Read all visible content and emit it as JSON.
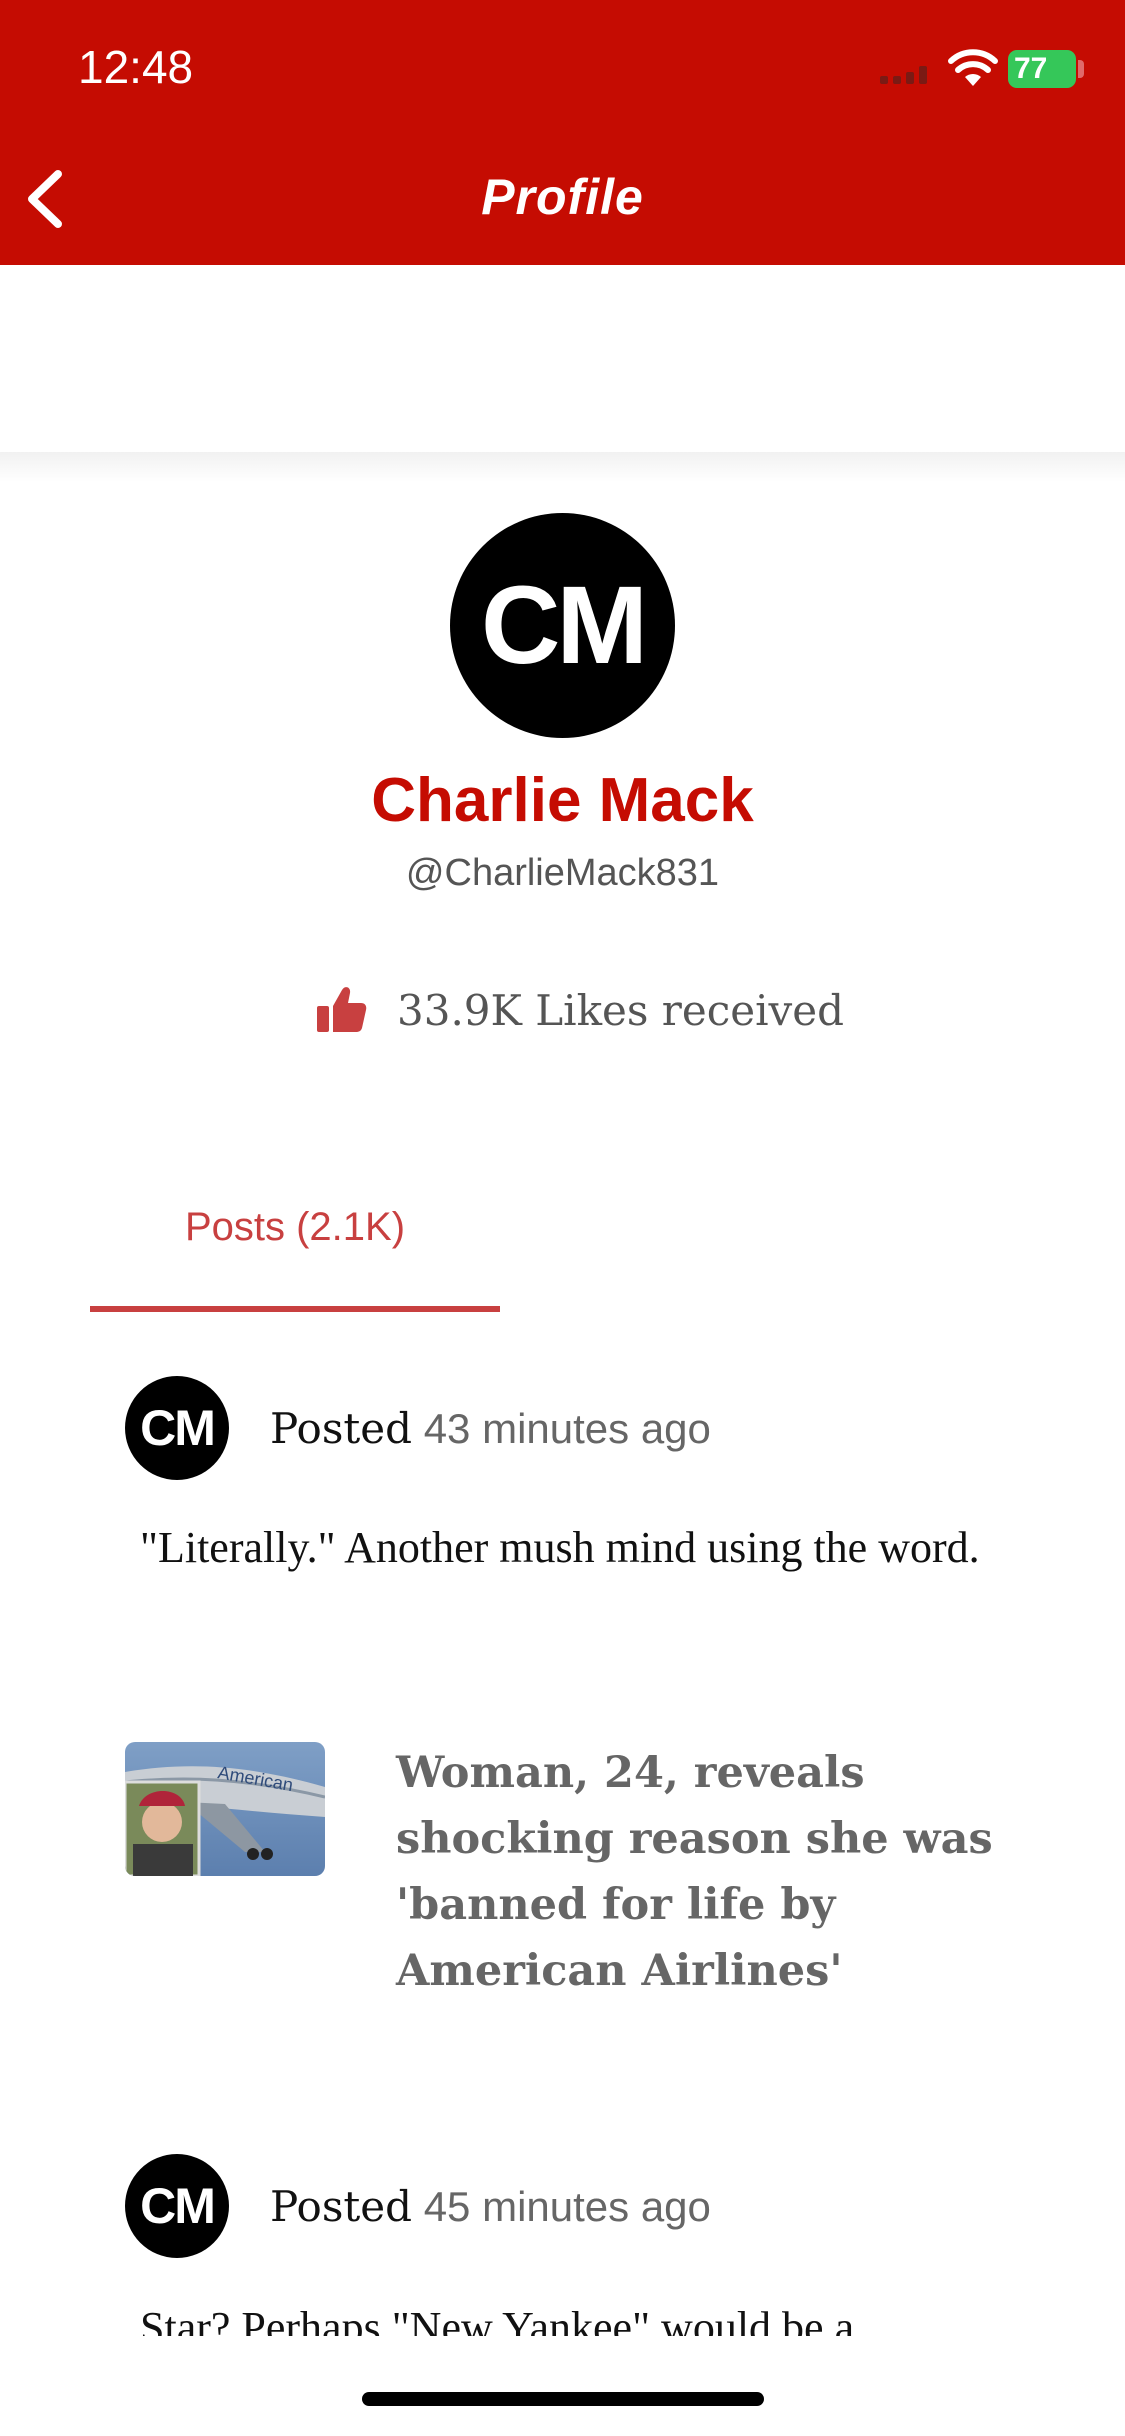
{
  "status_bar": {
    "time": "12:48",
    "battery": "77"
  },
  "header": {
    "title": "Profile"
  },
  "profile": {
    "initials": "CM",
    "name": "Charlie Mack",
    "handle": "@CharlieMack831",
    "likes": "33.9K Likes received"
  },
  "tabs": [
    {
      "label": "Posts (2.1K)",
      "active": true
    }
  ],
  "posts": [
    {
      "initials": "CM",
      "posted_prefix": "Posted",
      "time_ago": "43 minutes ago",
      "text": "\"Literally.\" Another mush mind using the word.",
      "article_headline": "Woman, 24, reveals shocking reason she was 'banned for life by American Airlines'"
    },
    {
      "initials": "CM",
      "posted_prefix": "Posted",
      "time_ago": "45 minutes ago",
      "text": "Star? Perhaps \"New Yankee\" would be a"
    }
  ],
  "colors": {
    "brand_red": "#c50c02",
    "tab_red": "#c84040",
    "battery_green": "#35c759"
  }
}
